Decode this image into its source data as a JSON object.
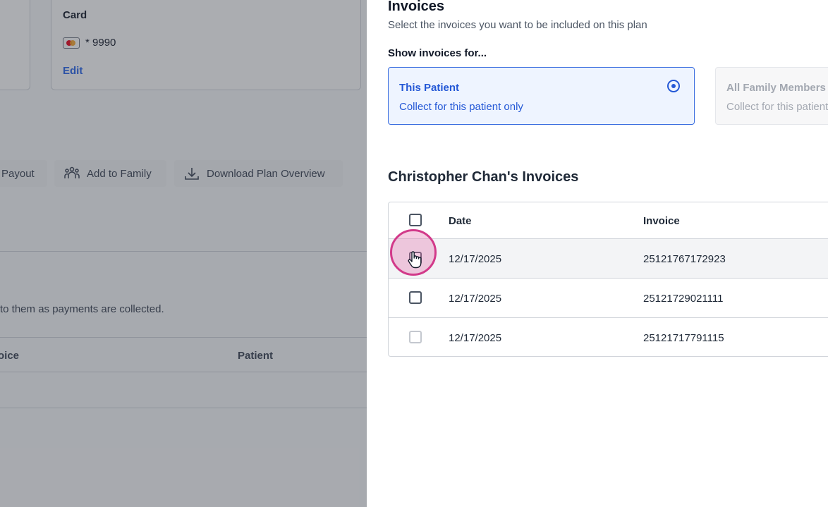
{
  "background": {
    "card": {
      "title": "Card",
      "last4": "* 9990",
      "edit_label": "Edit",
      "icon": "credit-card-icon"
    },
    "buttons": [
      {
        "label": "Payout"
      },
      {
        "label": "Add to Family",
        "icon": "family-icon"
      },
      {
        "label": "Download Plan Overview",
        "icon": "download-icon"
      }
    ],
    "helper_text": "to them as payments are collected.",
    "table_headers": {
      "invoice": "oice",
      "patient": "Patient"
    }
  },
  "drawer": {
    "title": "Invoices",
    "subtitle": "Select the invoices you want to be included on this plan",
    "show_for_label": "Show invoices for...",
    "options": [
      {
        "title": "This Patient",
        "description": "Collect for this patient only",
        "selected": true
      },
      {
        "title": "All Family Members",
        "description": "Collect for this patient and family members",
        "selected": false
      }
    ],
    "section_title": "Christopher Chan's Invoices",
    "table": {
      "headers": {
        "date": "Date",
        "invoice": "Invoice"
      },
      "rows": [
        {
          "date": "12/17/2025",
          "invoice": "25121767172923"
        },
        {
          "date": "12/17/2025",
          "invoice": "25121729021111"
        },
        {
          "date": "12/17/2025",
          "invoice": "25121717791115"
        }
      ]
    }
  },
  "colors": {
    "accent": "#2458d6",
    "click_indicator": "#d23a8a",
    "overlay": "#373c46"
  }
}
